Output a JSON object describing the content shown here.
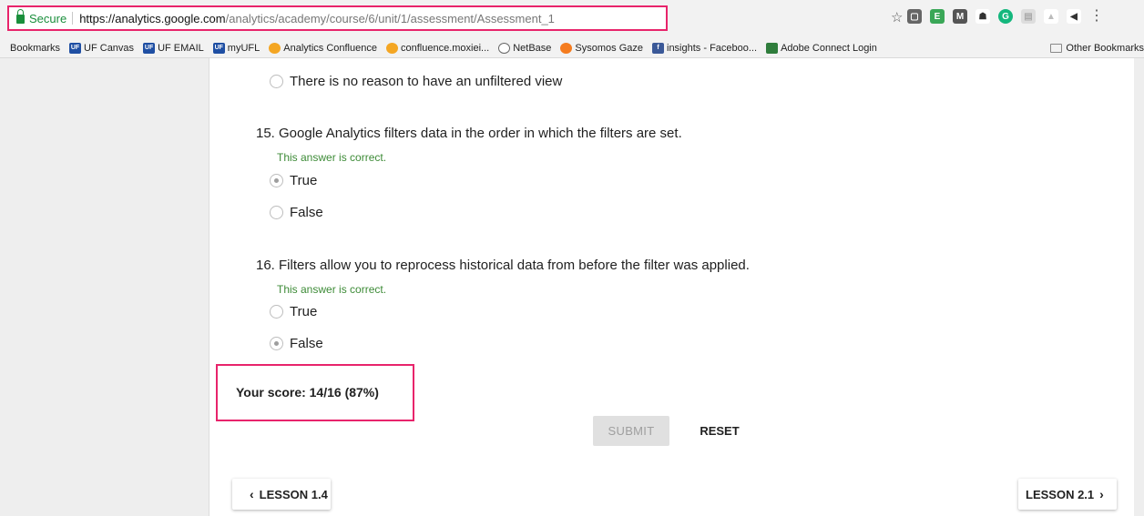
{
  "browser": {
    "secure_label": "Secure",
    "url_host": "https://analytics.google.com",
    "url_path": "/analytics/academy/course/6/unit/1/assessment/Assessment_1",
    "bookmarks": [
      {
        "label": "Bookmarks",
        "icon": ""
      },
      {
        "label": "UF Canvas",
        "icon": "UF"
      },
      {
        "label": "UF EMAIL",
        "icon": "UF"
      },
      {
        "label": "myUFL",
        "icon": "UF"
      },
      {
        "label": "Analytics Confluence",
        "icon": "confluence"
      },
      {
        "label": "confluence.moxiei...",
        "icon": "confluence"
      },
      {
        "label": "NetBase",
        "icon": "netbase"
      },
      {
        "label": "Sysomos Gaze",
        "icon": "sysomos"
      },
      {
        "label": "insights - Faceboo...",
        "icon": "facebook"
      },
      {
        "label": "Adobe Connect Login",
        "icon": "adobe"
      }
    ],
    "more_label": "»",
    "other_bookmarks": "Other Bookmarks"
  },
  "quiz": {
    "prev_option": "There is no reason to have an unfiltered view",
    "q15": {
      "text": "15. Google Analytics filters data in the order in which the filters are set.",
      "feedback": "This answer is correct.",
      "options": [
        "True",
        "False"
      ]
    },
    "q16": {
      "text": "16. Filters allow you to reprocess historical data from before the filter was applied.",
      "feedback": "This answer is correct.",
      "options": [
        "True",
        "False"
      ]
    },
    "score": "Your score: 14/16 (87%)",
    "submit_label": "SUBMIT",
    "reset_label": "RESET"
  },
  "nav": {
    "prev_label": "LESSON 1.4",
    "next_label": "LESSON 2.1"
  },
  "colors": {
    "highlight": "#e8246b",
    "correct": "#3d8b37",
    "secure": "#1a8f3c"
  }
}
